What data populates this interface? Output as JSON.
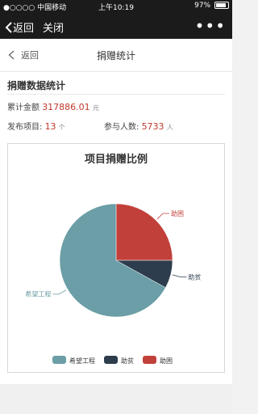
{
  "status_bar": {
    "carrier": "●○○○○ 中国移动",
    "time": "上午10:19",
    "battery": "97%"
  },
  "wechat_bar": {
    "back_label": "返回",
    "close_label": "关闭",
    "more_label": "•••"
  },
  "header": {
    "back_label": "返回",
    "title": "捐赠统计"
  },
  "section": {
    "title": "捐赠数据统计"
  },
  "stats": {
    "total_label": "累计金额",
    "total_value": "317886.01",
    "total_unit": "元",
    "projects_label": "发布项目:",
    "projects_value": "13",
    "projects_unit": "个",
    "participants_label": "参与人数:",
    "participants_value": "5733",
    "participants_unit": "人"
  },
  "colors": {
    "希望工程": "#6b9ea6",
    "助贫": "#2e3d4d",
    "助困": "#c1403a"
  },
  "chart_data": {
    "type": "pie",
    "title": "项目捐赠比例",
    "legend_position": "bottom",
    "slices": [
      {
        "label": "希望工程",
        "value": 67
      },
      {
        "label": "助贫",
        "value": 8
      },
      {
        "label": "助困",
        "value": 25
      }
    ]
  }
}
